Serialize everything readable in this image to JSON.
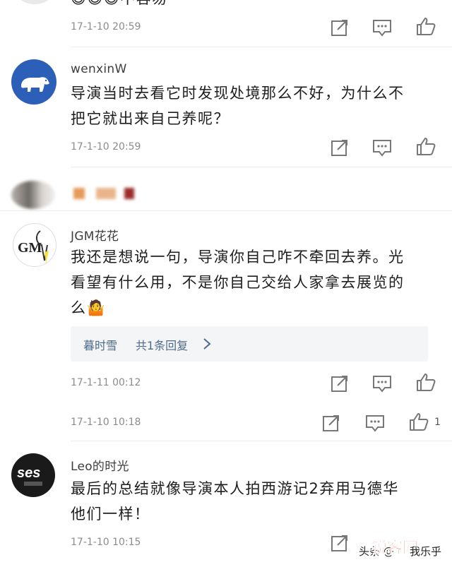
{
  "comments": [
    {
      "text": "😄😄😄不容易",
      "time": "17-1-10 20:59"
    },
    {
      "username": "wenxinW",
      "text_line1": "导演当时去看它时发现处境那么不好，为什么不",
      "text_line2": "把它就出来自己养呢？",
      "time": "17-1-10 20:59"
    },
    {
      "username_blurred": true
    },
    {
      "username": "JGM花花",
      "text_line1": "我还是想说一句，导演你自己咋不牵回去养。光",
      "text_line2": "看望有什么用，不是你自己交给人家拿去展览的",
      "text_line3": "么🤷",
      "reply_author": "暮时雪",
      "reply_count_text": "共1条回复",
      "time": "17-1-11 00:12"
    },
    {
      "time": "17-1-10 10:18",
      "like_count": "1"
    },
    {
      "username": "Leo的时光",
      "text_line1": "最后的总结就像导演本人拍西游记2弃用马德华",
      "text_line2": "他们一样！",
      "time": "17-1-10 10:15"
    }
  ],
  "watermark": {
    "source": "头条 @",
    "brand": "锐客网",
    "author": "我乐乎"
  },
  "icons": [
    "share-icon",
    "comment-icon",
    "like-icon"
  ],
  "colors": {
    "avatar_blue": "#2c5fb8",
    "text": "#1e1e1e",
    "meta": "#8c8c8c",
    "reply_link": "#4d6b8a",
    "watermark_red": "#e8321c"
  }
}
